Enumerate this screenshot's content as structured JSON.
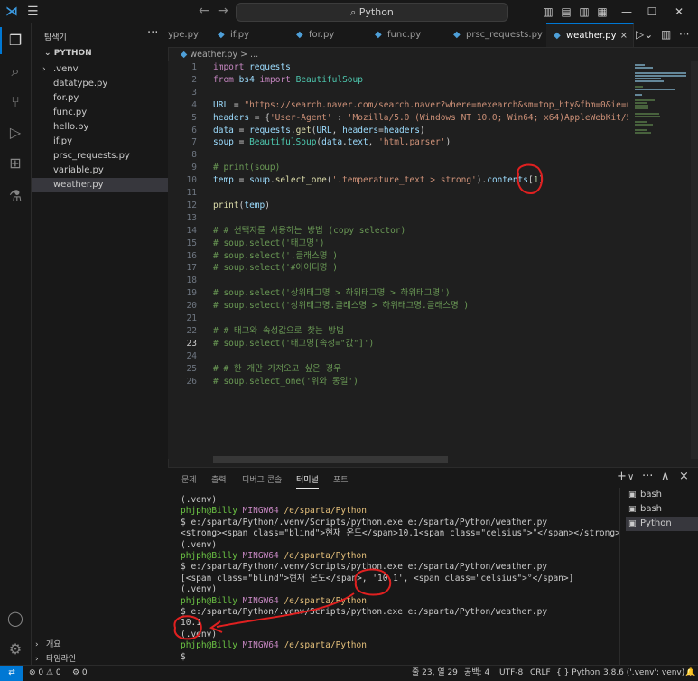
{
  "titlebar": {
    "search": "Python",
    "icons": [
      "vscode-logo",
      "menu-icon",
      "back-arrow-icon",
      "forward-arrow-icon",
      "search-icon",
      "toggle-sidebar-icon",
      "toggle-panel-icon",
      "toggle-secondary-icon",
      "layout-icon",
      "minimize-icon",
      "maximize-icon",
      "close-icon"
    ]
  },
  "sidebar": {
    "header": "탐색기",
    "more": "···",
    "folder": "PYTHON",
    "files": [
      {
        "name": ".venv",
        "type": "folder"
      },
      {
        "name": "datatype.py"
      },
      {
        "name": "for.py"
      },
      {
        "name": "func.py"
      },
      {
        "name": "hello.py"
      },
      {
        "name": "if.py"
      },
      {
        "name": "prsc_requests.py"
      },
      {
        "name": "variable.py"
      },
      {
        "name": "weather.py",
        "selected": true
      }
    ],
    "sections": [
      "개요",
      "타임라인"
    ]
  },
  "tabs": [
    {
      "label": "ype.py"
    },
    {
      "label": "if.py"
    },
    {
      "label": "for.py"
    },
    {
      "label": "func.py"
    },
    {
      "label": "prsc_requests.py"
    },
    {
      "label": "weather.py",
      "active": true,
      "close": "×"
    }
  ],
  "breadcrumb": "weather.py > ...",
  "editor": {
    "line_numbers": [
      "1",
      "2",
      "3",
      "4",
      "5",
      "6",
      "7",
      "8",
      "9",
      "10",
      "11",
      "12",
      "13",
      "14",
      "15",
      "16",
      "17",
      "18",
      "19",
      "20",
      "21",
      "22",
      "23",
      "24",
      "25",
      "26"
    ],
    "current_line": "23",
    "lines": [
      "import requests",
      "from bs4 import BeautifulSoup",
      "",
      "URL = \"https://search.naver.com/search.naver?where=nexearch&sm=top_hty&fbm=0&ie=ut",
      "headers = {'User-Agent' : 'Mozilla/5.0 (Windows NT 10.0; Win64; x64)AppleWebKit/53",
      "data = requests.get(URL, headers=headers)",
      "soup = BeautifulSoup(data.text, 'html.parser')",
      "",
      "# print(soup)",
      "temp = soup.select_one('.temperature_text > strong').contents[1]",
      "",
      "print(temp)",
      "",
      "# # 선택자를 사용하는 방법 (copy selector)",
      "# soup.select('태그명')",
      "# soup.select('.클래스명')",
      "# soup.select('#아이디명')",
      "",
      "# soup.select('상위태그명 > 하위태그명 > 하위태그명')",
      "# soup.select('상위태그명.클래스명 > 하위태그명.클래스명')",
      "",
      "# # 태그와 속성값으로 찾는 방법",
      "# soup.select('태그명[속성=\"값\"]')",
      "",
      "# # 한 개만 가져오고 싶은 경우",
      "# soup.select_one('위와 동일')"
    ]
  },
  "panel": {
    "tabs": [
      "문제",
      "출력",
      "디버그 콘솔",
      "터미널",
      "포트"
    ],
    "active_tab": "터미널",
    "tools": [
      "+",
      "∨",
      "···",
      "∧",
      "×"
    ],
    "terminals": [
      {
        "label": "bash",
        "icon": "terminal-icon"
      },
      {
        "label": "bash",
        "icon": "terminal-icon"
      },
      {
        "label": "Python",
        "icon": "terminal-icon",
        "active": true
      }
    ],
    "terminal_lines": [
      {
        "kind": "plain",
        "text": "(.venv)"
      },
      {
        "kind": "prompt",
        "user": "phjph@Billy",
        "host": "MINGW64",
        "path": "/e/sparta/Python"
      },
      {
        "kind": "plain",
        "text": "$ e:/sparta/Python/.venv/Scripts/python.exe e:/sparta/Python/weather.py"
      },
      {
        "kind": "plain",
        "text": "<strong><span class=\"blind\">현재 온도</span>10.1<span class=\"celsius\">°</span></strong>"
      },
      {
        "kind": "plain",
        "text": "(.venv)"
      },
      {
        "kind": "prompt",
        "user": "phjph@Billy",
        "host": "MINGW64",
        "path": "/e/sparta/Python"
      },
      {
        "kind": "plain",
        "text": "$ e:/sparta/Python/.venv/Scripts/python.exe e:/sparta/Python/weather.py"
      },
      {
        "kind": "plain",
        "text": "[<span class=\"blind\">현재 온도</span>, '10.1', <span class=\"celsius\">°</span>]"
      },
      {
        "kind": "plain",
        "text": "(.venv)"
      },
      {
        "kind": "prompt",
        "user": "phjph@Billy",
        "host": "MINGW64",
        "path": "/e/sparta/Python"
      },
      {
        "kind": "plain",
        "text": "$ e:/sparta/Python/.venv/Scripts/python.exe e:/sparta/Python/weather.py"
      },
      {
        "kind": "plain",
        "text": "10.1"
      },
      {
        "kind": "plain",
        "text": "(.venv)"
      },
      {
        "kind": "prompt",
        "user": "phjph@Billy",
        "host": "MINGW64",
        "path": "/e/sparta/Python"
      },
      {
        "kind": "plain",
        "text": "$"
      }
    ]
  },
  "statusbar": {
    "remote": "⇄",
    "problems": "⊗ 0 ⚠ 0",
    "ports": "⚙ 0",
    "position": "줄 23, 열 29",
    "spaces": "공백: 4",
    "encoding": "UTF-8",
    "eol": "CRLF",
    "language": "{ } Python",
    "interpreter": "3.8.6 ('.venv': venv)",
    "notifications": "🔔"
  },
  "colors": {
    "accent": "#0078d4",
    "annotation": "#e02020"
  }
}
